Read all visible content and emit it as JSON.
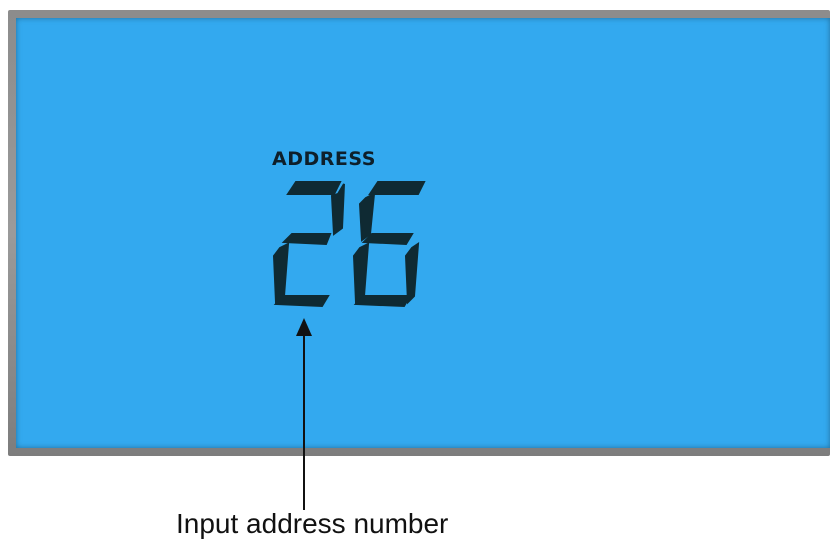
{
  "display": {
    "label": "ADDRESS",
    "value": "26"
  },
  "caption": "Input address number",
  "colors": {
    "lcd_background": "#33a9ef",
    "segment": "#0f2a33",
    "bezel": "#8c8c8c"
  },
  "icons": {
    "pointer": "arrow-up-icon"
  }
}
